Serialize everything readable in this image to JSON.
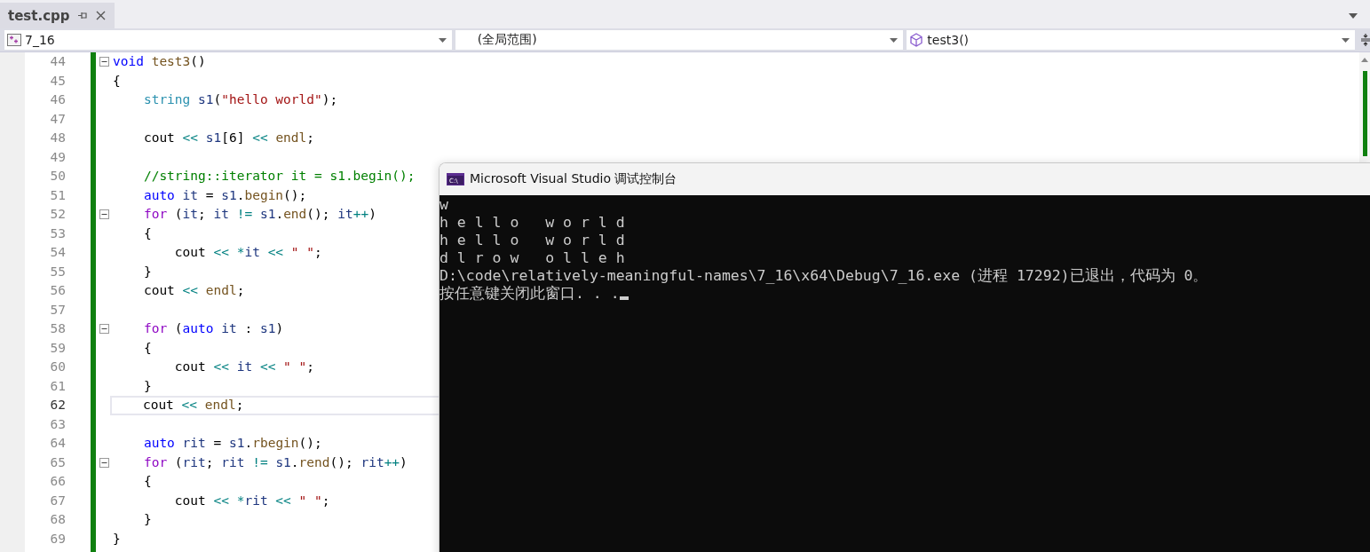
{
  "tabs": [
    {
      "label": "test.cpp",
      "selected": true
    }
  ],
  "nav_bar": {
    "project": "7_16",
    "scope": "(全局范围)",
    "member": "test3()"
  },
  "code_lines": [
    {
      "number": "44",
      "fold": true,
      "current": false,
      "tokens": [
        {
          "text": "void ",
          "kind": "kw"
        },
        {
          "text": "test3",
          "kind": "fn"
        },
        {
          "text": "()",
          "kind": "plain"
        }
      ]
    },
    {
      "number": "45",
      "fold": false,
      "current": false,
      "tokens": [
        {
          "text": "{",
          "kind": "plain"
        }
      ]
    },
    {
      "number": "46",
      "fold": false,
      "current": false,
      "tokens": [
        {
          "text": "    string ",
          "kind": "type"
        },
        {
          "text": "s1",
          "kind": "var"
        },
        {
          "text": "(",
          "kind": "plain"
        },
        {
          "text": "\"hello world\"",
          "kind": "str"
        },
        {
          "text": ");",
          "kind": "plain"
        }
      ]
    },
    {
      "number": "47",
      "fold": false,
      "current": false
    },
    {
      "number": "48",
      "fold": false,
      "current": false,
      "tokens": [
        {
          "text": "    cout ",
          "kind": "plain"
        },
        {
          "text": "<< ",
          "kind": "op"
        },
        {
          "text": "s1",
          "kind": "var"
        },
        {
          "text": "[6] ",
          "kind": "plain"
        },
        {
          "text": "<< ",
          "kind": "op"
        },
        {
          "text": "endl",
          "kind": "fn"
        },
        {
          "text": ";",
          "kind": "plain"
        }
      ]
    },
    {
      "number": "49",
      "fold": false,
      "current": false
    },
    {
      "number": "50",
      "fold": false,
      "current": false,
      "tokens": [
        {
          "text": "    //string::iterator it = s1.begin();",
          "kind": "cmt"
        }
      ]
    },
    {
      "number": "51",
      "fold": false,
      "current": false,
      "tokens": [
        {
          "text": "    auto ",
          "kind": "kw"
        },
        {
          "text": "it",
          "kind": "var"
        },
        {
          "text": " = ",
          "kind": "plain"
        },
        {
          "text": "s1",
          "kind": "var"
        },
        {
          "text": ".",
          "kind": "plain"
        },
        {
          "text": "begin",
          "kind": "fn"
        },
        {
          "text": "();",
          "kind": "plain"
        }
      ]
    },
    {
      "number": "52",
      "fold": true,
      "current": false,
      "tokens": [
        {
          "text": "    for",
          "kind": "ctl"
        },
        {
          "text": " (",
          "kind": "plain"
        },
        {
          "text": "it",
          "kind": "var"
        },
        {
          "text": "; ",
          "kind": "plain"
        },
        {
          "text": "it ",
          "kind": "var"
        },
        {
          "text": "!= ",
          "kind": "op"
        },
        {
          "text": "s1",
          "kind": "var"
        },
        {
          "text": ".",
          "kind": "plain"
        },
        {
          "text": "end",
          "kind": "fn"
        },
        {
          "text": "(); ",
          "kind": "plain"
        },
        {
          "text": "it",
          "kind": "var"
        },
        {
          "text": "++",
          "kind": "op"
        },
        {
          "text": ")",
          "kind": "plain"
        }
      ]
    },
    {
      "number": "53",
      "fold": false,
      "current": false,
      "tokens": [
        {
          "text": "    {",
          "kind": "plain"
        }
      ]
    },
    {
      "number": "54",
      "fold": false,
      "current": false,
      "tokens": [
        {
          "text": "        cout ",
          "kind": "plain"
        },
        {
          "text": "<< *",
          "kind": "op"
        },
        {
          "text": "it ",
          "kind": "var"
        },
        {
          "text": "<< ",
          "kind": "op"
        },
        {
          "text": "\" \"",
          "kind": "str"
        },
        {
          "text": ";",
          "kind": "plain"
        }
      ]
    },
    {
      "number": "55",
      "fold": false,
      "current": false,
      "tokens": [
        {
          "text": "    }",
          "kind": "plain"
        }
      ]
    },
    {
      "number": "56",
      "fold": false,
      "current": false,
      "tokens": [
        {
          "text": "    cout ",
          "kind": "plain"
        },
        {
          "text": "<< ",
          "kind": "op"
        },
        {
          "text": "endl",
          "kind": "fn"
        },
        {
          "text": ";",
          "kind": "plain"
        }
      ]
    },
    {
      "number": "57",
      "fold": false,
      "current": false
    },
    {
      "number": "58",
      "fold": true,
      "current": false,
      "tokens": [
        {
          "text": "    for",
          "kind": "ctl"
        },
        {
          "text": " (",
          "kind": "plain"
        },
        {
          "text": "auto ",
          "kind": "kw"
        },
        {
          "text": "it",
          "kind": "var"
        },
        {
          "text": " : ",
          "kind": "plain"
        },
        {
          "text": "s1",
          "kind": "var"
        },
        {
          "text": ")",
          "kind": "plain"
        }
      ]
    },
    {
      "number": "59",
      "fold": false,
      "current": false,
      "tokens": [
        {
          "text": "    {",
          "kind": "plain"
        }
      ]
    },
    {
      "number": "60",
      "fold": false,
      "current": false,
      "tokens": [
        {
          "text": "        cout ",
          "kind": "plain"
        },
        {
          "text": "<< ",
          "kind": "op"
        },
        {
          "text": "it ",
          "kind": "var"
        },
        {
          "text": "<< ",
          "kind": "op"
        },
        {
          "text": "\" \"",
          "kind": "str"
        },
        {
          "text": ";",
          "kind": "plain"
        }
      ]
    },
    {
      "number": "61",
      "fold": false,
      "current": false,
      "tokens": [
        {
          "text": "    }",
          "kind": "plain"
        }
      ]
    },
    {
      "number": "62",
      "fold": false,
      "current": true,
      "tokens": [
        {
          "text": "    cout ",
          "kind": "plain"
        },
        {
          "text": "<< ",
          "kind": "op"
        },
        {
          "text": "endl",
          "kind": "fn"
        },
        {
          "text": ";",
          "kind": "plain"
        }
      ]
    },
    {
      "number": "63",
      "fold": false,
      "current": false
    },
    {
      "number": "64",
      "fold": false,
      "current": false,
      "tokens": [
        {
          "text": "    auto ",
          "kind": "kw"
        },
        {
          "text": "rit",
          "kind": "var"
        },
        {
          "text": " = ",
          "kind": "plain"
        },
        {
          "text": "s1",
          "kind": "var"
        },
        {
          "text": ".",
          "kind": "plain"
        },
        {
          "text": "rbegin",
          "kind": "fn"
        },
        {
          "text": "();",
          "kind": "plain"
        }
      ]
    },
    {
      "number": "65",
      "fold": true,
      "current": false,
      "tokens": [
        {
          "text": "    for",
          "kind": "ctl"
        },
        {
          "text": " (",
          "kind": "plain"
        },
        {
          "text": "rit",
          "kind": "var"
        },
        {
          "text": "; ",
          "kind": "plain"
        },
        {
          "text": "rit ",
          "kind": "var"
        },
        {
          "text": "!= ",
          "kind": "op"
        },
        {
          "text": "s1",
          "kind": "var"
        },
        {
          "text": ".",
          "kind": "plain"
        },
        {
          "text": "rend",
          "kind": "fn"
        },
        {
          "text": "(); ",
          "kind": "plain"
        },
        {
          "text": "rit",
          "kind": "var"
        },
        {
          "text": "++",
          "kind": "op"
        },
        {
          "text": ")",
          "kind": "plain"
        }
      ]
    },
    {
      "number": "66",
      "fold": false,
      "current": false,
      "tokens": [
        {
          "text": "    {",
          "kind": "plain"
        }
      ]
    },
    {
      "number": "67",
      "fold": false,
      "current": false,
      "tokens": [
        {
          "text": "        cout ",
          "kind": "plain"
        },
        {
          "text": "<< *",
          "kind": "op"
        },
        {
          "text": "rit ",
          "kind": "var"
        },
        {
          "text": "<< ",
          "kind": "op"
        },
        {
          "text": "\" \"",
          "kind": "str"
        },
        {
          "text": ";",
          "kind": "plain"
        }
      ]
    },
    {
      "number": "68",
      "fold": false,
      "current": false,
      "tokens": [
        {
          "text": "    }",
          "kind": "plain"
        }
      ]
    },
    {
      "number": "69",
      "fold": false,
      "current": false,
      "tokens": [
        {
          "text": "}",
          "kind": "plain"
        }
      ]
    }
  ],
  "console": {
    "icon_text": "C:\\",
    "title": "Microsoft Visual Studio 调试控制台",
    "lines": [
      "w",
      "h e l l o   w o r l d",
      "h e l l o   w o r l d",
      "d l r o w   o l l e h",
      "D:\\code\\relatively-meaningful-names\\7_16\\x64\\Debug\\7_16.exe (进程 17292)已退出，代码为 0。",
      "按任意键关闭此窗口. . ."
    ],
    "cursor": true
  }
}
